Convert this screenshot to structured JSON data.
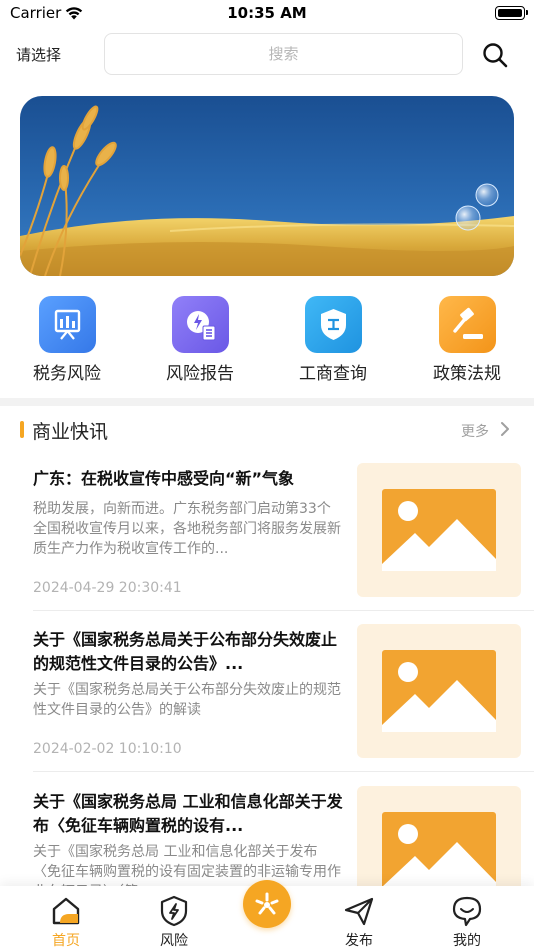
{
  "status_bar": {
    "carrier": "Carrier",
    "time": "10:35 AM"
  },
  "top_bar": {
    "select_label": "请选择",
    "search_placeholder": "搜索"
  },
  "quick_nav": [
    {
      "label": "税务风险",
      "icon": "tax-risk-icon",
      "color": "#4a8cf2"
    },
    {
      "label": "风险报告",
      "icon": "risk-report-icon",
      "color": "#7b6cf0"
    },
    {
      "label": "工商查询",
      "icon": "business-query-icon",
      "color": "#2ea8ea"
    },
    {
      "label": "政策法规",
      "icon": "policy-law-icon",
      "color": "#f5a623"
    }
  ],
  "section": {
    "title": "商业快讯",
    "more": "更多"
  },
  "news": [
    {
      "title": "广东：在税收宣传中感受向“新”气象",
      "desc": "税助发展，向新而进。广东税务部门启动第33个全国税收宣传月以来，各地税务部门将服务发展新质生产力作为税收宣传工作的...",
      "time": "2024-04-29 20:30:41"
    },
    {
      "title": "关于《国家税务总局关于公布部分失效废止的规范性文件目录的公告》...",
      "desc": "关于《国家税务总局关于公布部分失效废止的规范性文件目录的公告》的解读",
      "time": "2024-02-02 10:10:10"
    },
    {
      "title": "关于《国家税务总局 工业和信息化部关于发布〈免征车辆购置税的设有...",
      "desc": "关于《国家税务总局 工业和信息化部关于发布〈免征车辆购置税的设有固定装置的非运输专用作业车辆目录〉（第...",
      "time": ""
    }
  ],
  "tab_bar": [
    {
      "label": "首页",
      "icon": "home-icon",
      "active": true
    },
    {
      "label": "风险",
      "icon": "shield-icon",
      "active": false
    },
    {
      "label": "",
      "icon": "publish-fab-icon",
      "active": false
    },
    {
      "label": "发布",
      "icon": "send-icon",
      "active": false
    },
    {
      "label": "我的",
      "icon": "profile-icon",
      "active": false
    }
  ],
  "colors": {
    "accent": "#f5a623",
    "banner_sky": "#1f5a9e"
  }
}
